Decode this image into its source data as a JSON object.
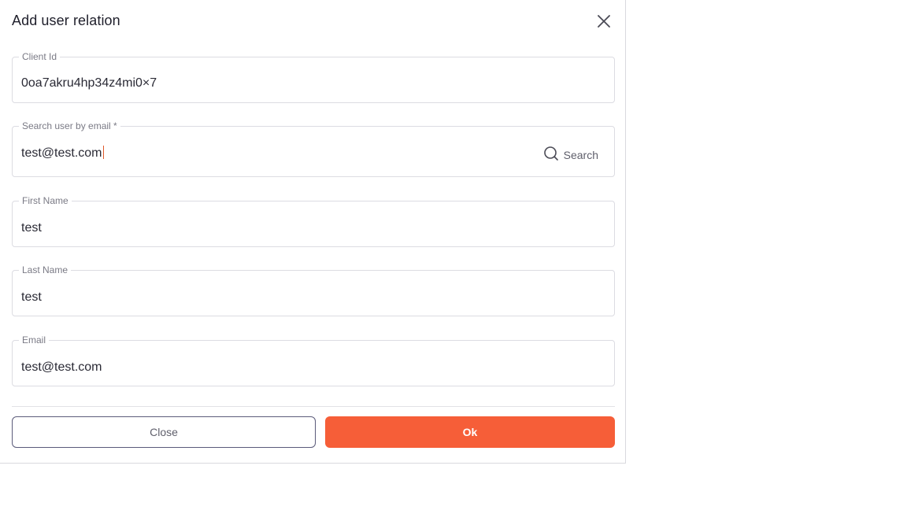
{
  "dialog": {
    "title": "Add user relation"
  },
  "fields": {
    "client_id": {
      "label": "Client Id",
      "value": "0oa7akru4hp34z4mi0×7"
    },
    "search_email": {
      "label": "Search user by email *",
      "value": "test@test.com",
      "button_label": "Search"
    },
    "first_name": {
      "label": "First Name",
      "value": "test"
    },
    "last_name": {
      "label": "Last Name",
      "value": "test"
    },
    "email": {
      "label": "Email",
      "value": "test@test.com"
    }
  },
  "actions": {
    "close_label": "Close",
    "ok_label": "Ok"
  },
  "icons": {
    "close": "close-icon",
    "search": "search-icon"
  },
  "colors": {
    "primary": "#f65e38",
    "outline": "#5b5b7a"
  }
}
